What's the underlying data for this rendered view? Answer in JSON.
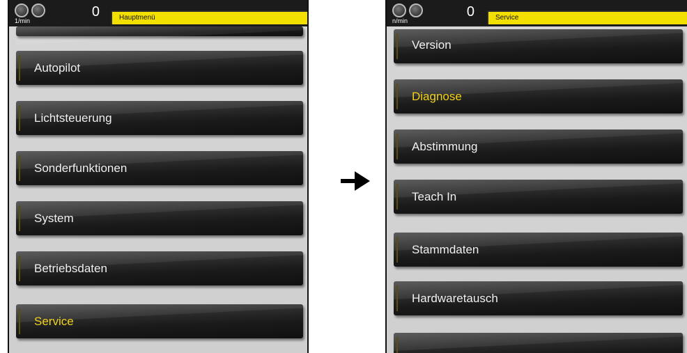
{
  "left_screen": {
    "status": {
      "unit": "1/min",
      "count": "0",
      "title": "Hauptmenü"
    },
    "items": [
      {
        "label": "Autopilot"
      },
      {
        "label": "Lichtsteuerung"
      },
      {
        "label": "Sonderfunktionen"
      },
      {
        "label": "System"
      },
      {
        "label": "Betriebsdaten"
      },
      {
        "label": "Service",
        "active": true
      }
    ]
  },
  "right_screen": {
    "status": {
      "unit": "n/min",
      "count": "0",
      "title": "Service"
    },
    "items": [
      {
        "label": "Version"
      },
      {
        "label": "Diagnose",
        "active": true
      },
      {
        "label": "Abstimmung"
      },
      {
        "label": "Teach In"
      },
      {
        "label": "Stammdaten"
      },
      {
        "label": "Hardwaretausch"
      }
    ]
  },
  "colors": {
    "title_bar": "#f3df00",
    "active_label": "#f2d21a",
    "button": "#1a1a1a"
  },
  "icons": {
    "transition": "right-arrow-icon",
    "gauge": "gauge-icon"
  }
}
